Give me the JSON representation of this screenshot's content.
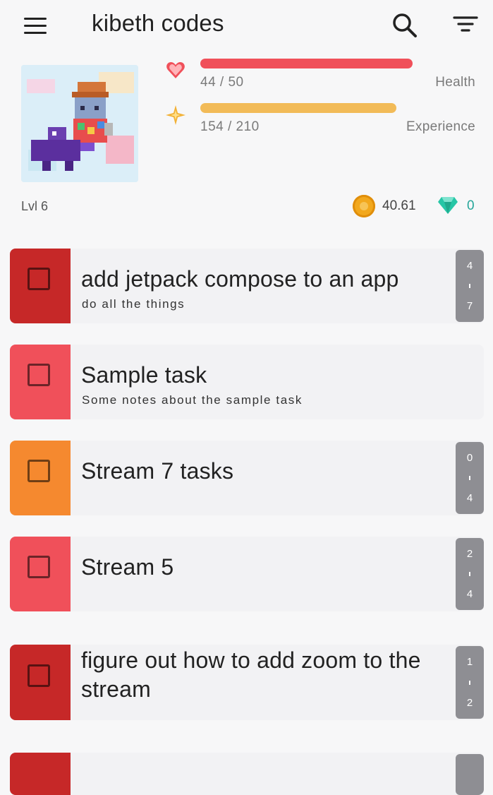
{
  "appbar": {
    "title": "kibeth codes",
    "menu_icon": "hamburger-menu-icon",
    "search_icon": "search-icon",
    "filter_icon": "filter-icon"
  },
  "stats": {
    "health": {
      "value_text": "44 / 50",
      "label": "Health",
      "current": 44,
      "max": 50,
      "color": "#f0505a"
    },
    "experience": {
      "value_text": "154 / 210",
      "label": "Experience",
      "current": 154,
      "max": 210,
      "color": "#f2bb58"
    },
    "level_text": "Lvl 6",
    "gold": "40.61",
    "gems": "0",
    "colors": {
      "gold": "#f2a81d",
      "gem": "#26c6a6"
    }
  },
  "tasks": [
    {
      "title": "add jetpack compose to an app",
      "notes": "do all the things",
      "checklist_done": "4",
      "checklist_total": "7",
      "color": "#c62828"
    },
    {
      "title": "Sample task",
      "notes": "Some notes about the sample task",
      "color": "#f0505a"
    },
    {
      "title": "Stream 7 tasks",
      "notes": "",
      "checklist_done": "0",
      "checklist_total": "4",
      "color": "#f5892f"
    },
    {
      "title": "Stream 5",
      "notes": "",
      "checklist_done": "2",
      "checklist_total": "4",
      "color": "#f0505a"
    },
    {
      "title": "figure out how to add zoom to the stream",
      "notes": "",
      "checklist_done": "1",
      "checklist_total": "2",
      "color": "#c62828"
    },
    {
      "title": "",
      "notes": "",
      "color": "#c62828"
    }
  ]
}
